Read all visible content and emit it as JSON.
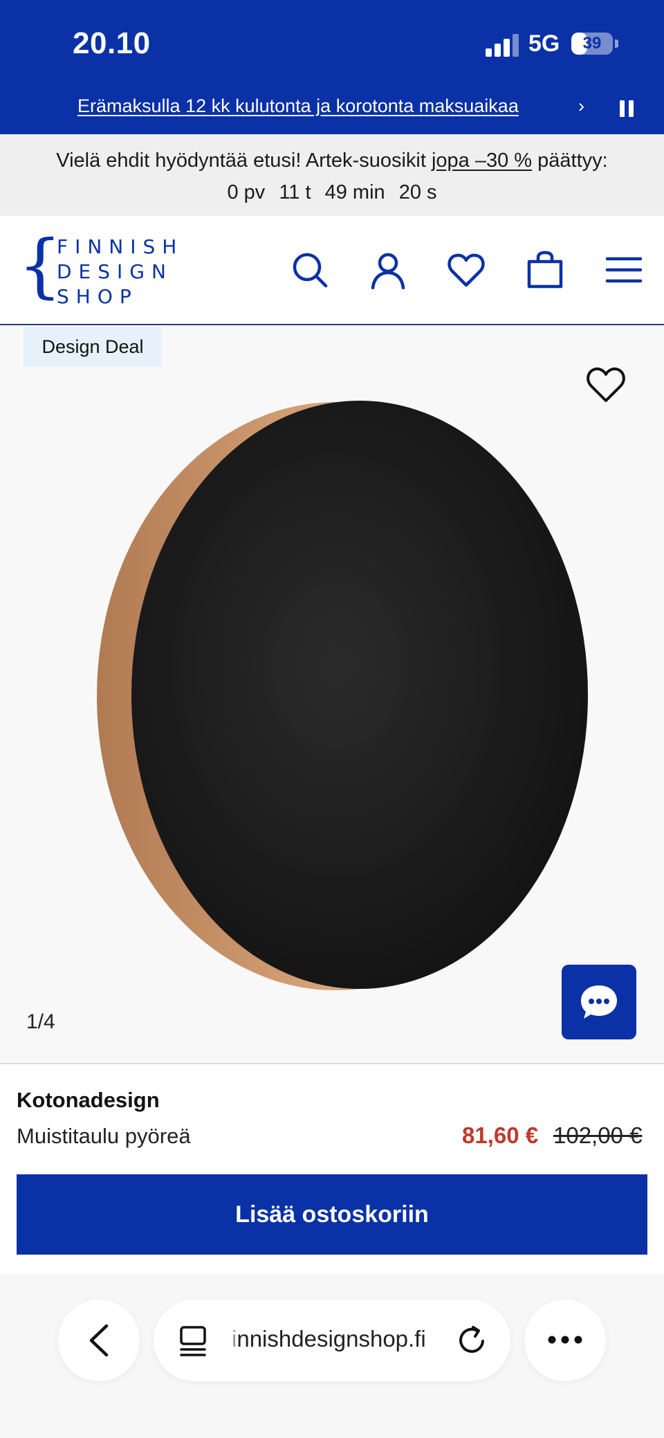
{
  "status_bar": {
    "time": "20.10",
    "network": "5G",
    "battery_percent": "39",
    "battery_level": 0.39
  },
  "promo": {
    "text": "Erämaksulla 12 kk kulutonta ja korotonta maksuaikaa",
    "chevron": "›",
    "pause_icon": "pause-icon"
  },
  "countdown": {
    "prefix": "Vielä ehdit hyödyntää etusi! Artek-suosikit",
    "link": "jopa –30 %",
    "suffix": "päättyy:",
    "days": "0 pv",
    "hours": "11 t",
    "minutes": "49 min",
    "seconds": "20 s"
  },
  "header": {
    "logo_lines": [
      "FINNISH",
      "DESIGN",
      "SHOP"
    ],
    "icons": [
      "search-icon",
      "user-icon",
      "heart-icon",
      "shopping-bag-icon",
      "menu-icon"
    ]
  },
  "gallery": {
    "badge": "Design Deal",
    "counter": "1/4",
    "wishlist_icon": "heart-icon",
    "chat_icon": "chat-icon"
  },
  "product": {
    "brand": "Kotonadesign",
    "name": "Muistitaulu pyöreä",
    "price": "81,60 €",
    "old_price": "102,00 €",
    "add_to_cart": "Lisää ostoskoriin"
  },
  "browser": {
    "url_faded": "i",
    "url": "nnishdesignshop.fi",
    "icons": [
      "back-icon",
      "reader-icon",
      "reload-icon",
      "more-icon"
    ]
  },
  "colors": {
    "brand_blue": "#0a31a6",
    "sale_red": "#c0392b",
    "banner_gray": "#efefef",
    "badge_bg": "#e6f1fb"
  }
}
